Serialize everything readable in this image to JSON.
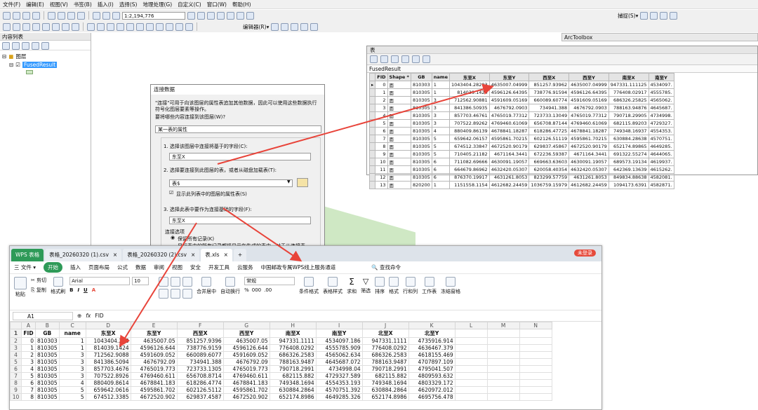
{
  "arcmap": {
    "menu": [
      "文件(F)",
      "编辑(E)",
      "视图(V)",
      "书签(B)",
      "插入(I)",
      "选择(S)",
      "地理处理(G)",
      "自定义(C)",
      "窗口(W)",
      "帮助(H)"
    ],
    "scale": "1:2,194,776",
    "editor_label": "编辑器(R)▾",
    "capture_label": "捕捉(S)▾"
  },
  "toc": {
    "title": "内容列表",
    "layers_group": "图层",
    "layer_name": "FusedResult"
  },
  "arctoolbox_title": "ArcToolbox",
  "attr_table": {
    "window_title": "表",
    "layer_tab": "FusedResult",
    "columns": [
      "FID",
      "Shape *",
      "GB",
      "name",
      "东至X",
      "东至Y",
      "西至X",
      "西至Y",
      "南至X",
      "南至Y"
    ],
    "rows": [
      [
        "0",
        "面",
        "810303",
        "1",
        "1043404.28283",
        "4635007.04999",
        "851257.93962",
        "4635007.04999",
        "947331.111125",
        "4534097."
      ],
      [
        "1",
        "面",
        "810305",
        "1",
        "814039.1424",
        "4596126.64395",
        "738776.91594",
        "4596126.64395",
        "776408.02917",
        "4555785."
      ],
      [
        "2",
        "面",
        "810305",
        "3",
        "712562.90881",
        "4591609.05169",
        "660089.60774",
        "4591609.05169",
        "686326.25825",
        "4565062."
      ],
      [
        "3",
        "面",
        "810305",
        "3",
        "841386.50935",
        "4676792.0903",
        "734941.388",
        "4676792.0903",
        "788163.94876",
        "4645687."
      ],
      [
        "4",
        "面",
        "810305",
        "3",
        "857703.46761",
        "4765019.77312",
        "723733.13049",
        "4765019.77312",
        "790718.29905",
        "4734998."
      ],
      [
        "5",
        "面",
        "810305",
        "3",
        "707522.89262",
        "4769460.61069",
        "656708.87144",
        "4769460.61069",
        "682115.89203",
        "4729327."
      ],
      [
        "6",
        "面",
        "810305",
        "4",
        "880409.86139",
        "4678841.18287",
        "618286.47725",
        "4678841.18287",
        "749348.16937",
        "4554353."
      ],
      [
        "7",
        "面",
        "810305",
        "5",
        "659642.06157",
        "4595861.70215",
        "602126.51119",
        "4595861.70215",
        "630884.28638",
        "4570751."
      ],
      [
        "8",
        "面",
        "810305",
        "5",
        "674512.33847",
        "4672520.90179",
        "629837.45867",
        "4672520.90179",
        "652174.89865",
        "4649285."
      ],
      [
        "9",
        "面",
        "810305",
        "5",
        "710405.21182",
        "4671164.3441",
        "672236.59387",
        "4671164.3441",
        "691322.55274",
        "4644065."
      ],
      [
        "10",
        "面",
        "810305",
        "6",
        "711082.69666",
        "4630091.19057",
        "669663.63603",
        "4630091.19057",
        "689573.19134",
        "4619937."
      ],
      [
        "11",
        "面",
        "810305",
        "6",
        "664679.86962",
        "4632420.05307",
        "620058.40354",
        "4632420.05307",
        "642369.13639",
        "4615262."
      ],
      [
        "12",
        "面",
        "810305",
        "6",
        "876370.19917",
        "4631261.8053",
        "823299.57759",
        "4631261.8053",
        "849834.88638",
        "4582081."
      ],
      [
        "13",
        "面",
        "820200",
        "1",
        "1151558.1154",
        "4612682.24459",
        "1036759.15979",
        "4612682.24459",
        "1094173.6391",
        "4582871."
      ]
    ]
  },
  "join_dialog": {
    "title": "连接数据",
    "intro": "\"连接\"可用于向该图层的属性表追加其他数据，因此可以使用这些数据执行符号化图层要素等操作。",
    "question": "要将哪些内容连接到该图层(W)?",
    "join_type": "某一表的属性",
    "step1": "1. 选择该图层中连接将基于的字段(C):",
    "step1_value": "东至X",
    "step2": "2. 选择要连接到此图层的表，或者从磁盘加载表(T):",
    "step2_value": "表$",
    "step2_check": "显示此列表中的图层的属性表(S)",
    "step3": "3. 选择此表中要作为连接基础的字段(F):",
    "step3_value": "东至X",
    "options_label": "连接选项",
    "option1": "保留所有记录(K)",
    "option1_desc": "目标表中的所有记录都将显示在生成的表中。对于从连接表"
  },
  "wps": {
    "tabs": [
      {
        "label": "WPS 表格",
        "kind": "brand"
      },
      {
        "label": "表格_20260320 (1).csv",
        "kind": "normal"
      },
      {
        "label": "表格_20260320 (2).csv",
        "kind": "normal"
      },
      {
        "label": "表.xls",
        "kind": "active"
      }
    ],
    "login_label": "未登录",
    "file_menu": "三 文件 ▾",
    "start_label": "开始",
    "menu": [
      "插入",
      "页面布局",
      "公式",
      "数据",
      "审阅",
      "视图",
      "安全",
      "开发工具",
      "云服务",
      "中国邮政专属WPS线上服务通道"
    ],
    "search_label": "查找命令",
    "ribbon": {
      "cut": "剪切",
      "copy": "复制",
      "format_painter": "格式刷",
      "paste": "粘贴",
      "font": "Arial",
      "size": "10",
      "merge": "合并居中",
      "wrap": "自动换行",
      "number_format": "常规",
      "cond_format": "条件格式",
      "table_style": "表格样式",
      "sum": "求和",
      "filter": "筛选",
      "sort": "排序",
      "format": "格式",
      "rowcol": "行和列",
      "sheet": "工作表",
      "freeze": "冻结窗格"
    },
    "cell_ref": "A1",
    "formula_value": "FID",
    "col_letters": [
      "A",
      "B",
      "C",
      "D",
      "E",
      "F",
      "G",
      "H",
      "I",
      "J",
      "K",
      "L",
      "M",
      "N"
    ],
    "header_row": [
      "FID",
      "GB",
      "name",
      "东至X",
      "东至Y",
      "西至X",
      "西至Y",
      "南至X",
      "南至Y",
      "北至X",
      "北至Y"
    ],
    "rows": [
      [
        "0",
        "810303",
        "1",
        "1043404.283",
        "4635007.05",
        "851257.9396",
        "4635007.05",
        "947331.1111",
        "4534097.186",
        "947331.1111",
        "4735916.914"
      ],
      [
        "1",
        "810305",
        "1",
        "814039.1424",
        "4596126.644",
        "738776.9159",
        "4596126.644",
        "776408.0292",
        "4555785.909",
        "776408.0292",
        "4636467.379"
      ],
      [
        "2",
        "810305",
        "3",
        "712562.9088",
        "4591609.052",
        "660089.6077",
        "4591609.052",
        "686326.2583",
        "4565062.634",
        "686326.2583",
        "4618155.469"
      ],
      [
        "3",
        "810305",
        "3",
        "841386.5094",
        "4676792.09",
        "734941.388",
        "4676792.09",
        "788163.9487",
        "4645687.072",
        "788163.9487",
        "4707897.109"
      ],
      [
        "4",
        "810305",
        "3",
        "857703.4676",
        "4765019.773",
        "723733.1305",
        "4765019.773",
        "790718.2991",
        "4734998.04",
        "790718.2991",
        "4795041.507"
      ],
      [
        "5",
        "810305",
        "3",
        "707522.8926",
        "4769460.611",
        "656708.8714",
        "4769460.611",
        "682115.882",
        "4729327.589",
        "682115.882",
        "4809593.632"
      ],
      [
        "6",
        "810305",
        "4",
        "880409.8614",
        "4678841.183",
        "618286.4774",
        "4678841.183",
        "749348.1694",
        "4554353.193",
        "749348.1694",
        "4803329.172"
      ],
      [
        "7",
        "810305",
        "5",
        "659642.0616",
        "4595861.702",
        "602126.5112",
        "4595861.702",
        "630884.2864",
        "4570751.392",
        "630884.2864",
        "4620972.012"
      ],
      [
        "8",
        "810305",
        "5",
        "674512.3385",
        "4672520.902",
        "629837.4587",
        "4672520.902",
        "652174.8986",
        "4649285.326",
        "652174.8986",
        "4695756.478"
      ]
    ]
  },
  "colors": {
    "arrow": "#e8443a",
    "wps_green": "#2e9a58",
    "selection_blue": "#3399ff"
  }
}
